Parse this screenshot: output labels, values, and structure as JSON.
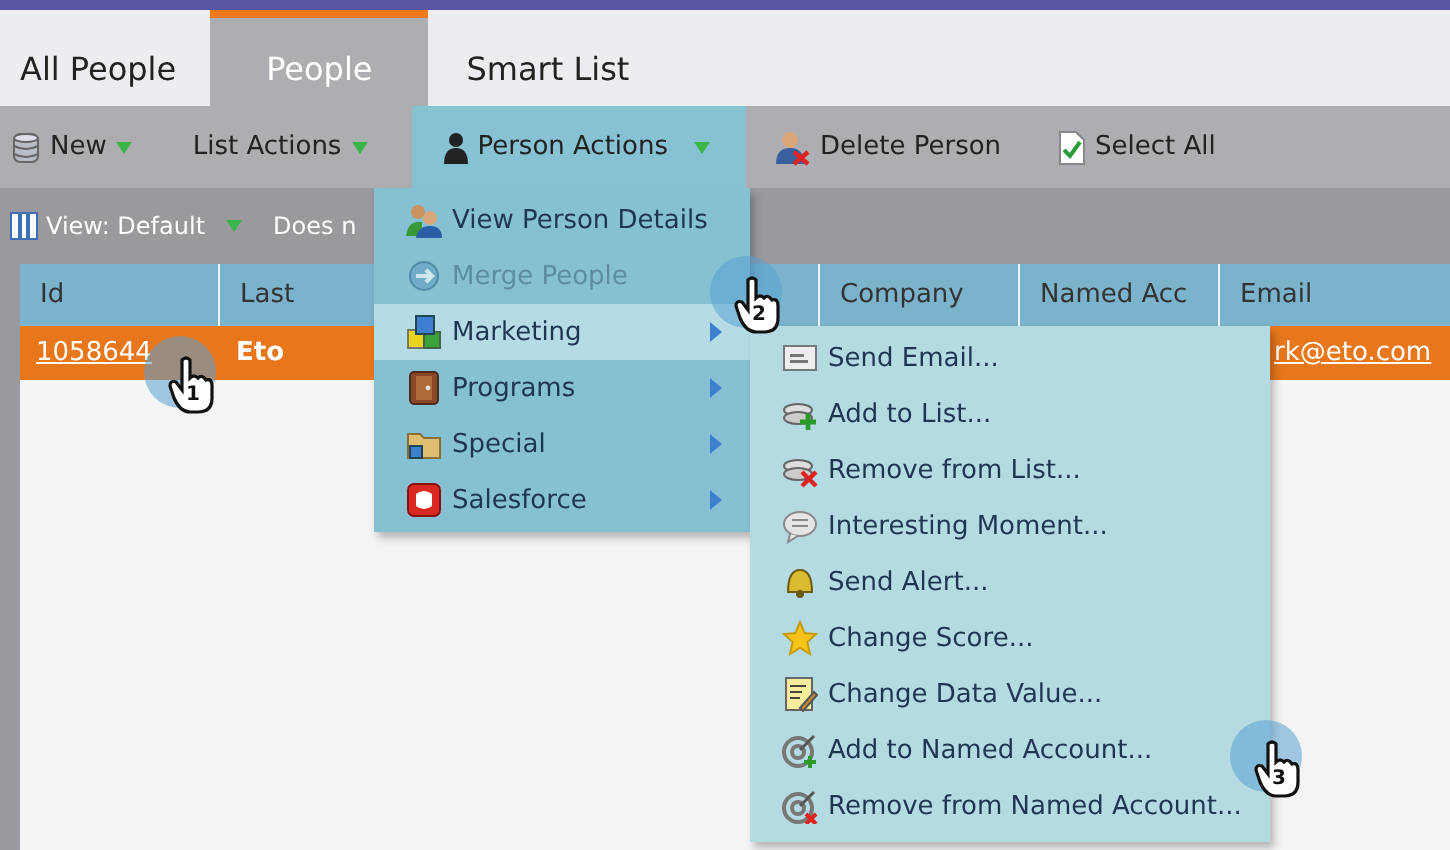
{
  "tabs": [
    {
      "label": "All People",
      "selected": false
    },
    {
      "label": "People",
      "selected": true
    },
    {
      "label": "Smart List",
      "selected": false
    }
  ],
  "toolbar": [
    {
      "label": "New",
      "dropdown": true,
      "selected": false
    },
    {
      "label": "List Actions",
      "dropdown": true,
      "selected": false
    },
    {
      "label": "Person Actions",
      "dropdown": true,
      "selected": true
    },
    {
      "label": "Delete Person",
      "dropdown": false,
      "selected": false
    },
    {
      "label": "Select All",
      "dropdown": false,
      "selected": false
    }
  ],
  "view_bar": {
    "view": "View: Default",
    "filter": "Does n"
  },
  "table": {
    "columns": [
      "Id",
      "Last",
      "Company",
      "Named Acc",
      "Email"
    ],
    "rows": [
      {
        "selected": true,
        "id": "1058644",
        "last": "Eto",
        "email": "rk@eto.com"
      }
    ]
  },
  "person_actions_menu": [
    {
      "label": "View Person Details",
      "disabled": false,
      "highlighted": false,
      "submenu": false
    },
    {
      "label": "Merge People",
      "disabled": true,
      "highlighted": false,
      "submenu": false
    },
    {
      "label": "Marketing",
      "disabled": false,
      "highlighted": true,
      "submenu": true
    },
    {
      "label": "Programs",
      "disabled": false,
      "highlighted": false,
      "submenu": true
    },
    {
      "label": "Special",
      "disabled": false,
      "highlighted": false,
      "submenu": true
    },
    {
      "label": "Salesforce",
      "disabled": false,
      "highlighted": false,
      "submenu": true
    }
  ],
  "marketing_submenu": [
    {
      "label": "Send Email..."
    },
    {
      "label": "Add to List..."
    },
    {
      "label": "Remove from List..."
    },
    {
      "label": "Interesting Moment..."
    },
    {
      "label": "Send Alert..."
    },
    {
      "label": "Change Score..."
    },
    {
      "label": "Change Data Value..."
    },
    {
      "label": "Add to Named Account..."
    },
    {
      "label": "Remove from Named Account..."
    }
  ],
  "steps": [
    "1",
    "2",
    "3"
  ]
}
